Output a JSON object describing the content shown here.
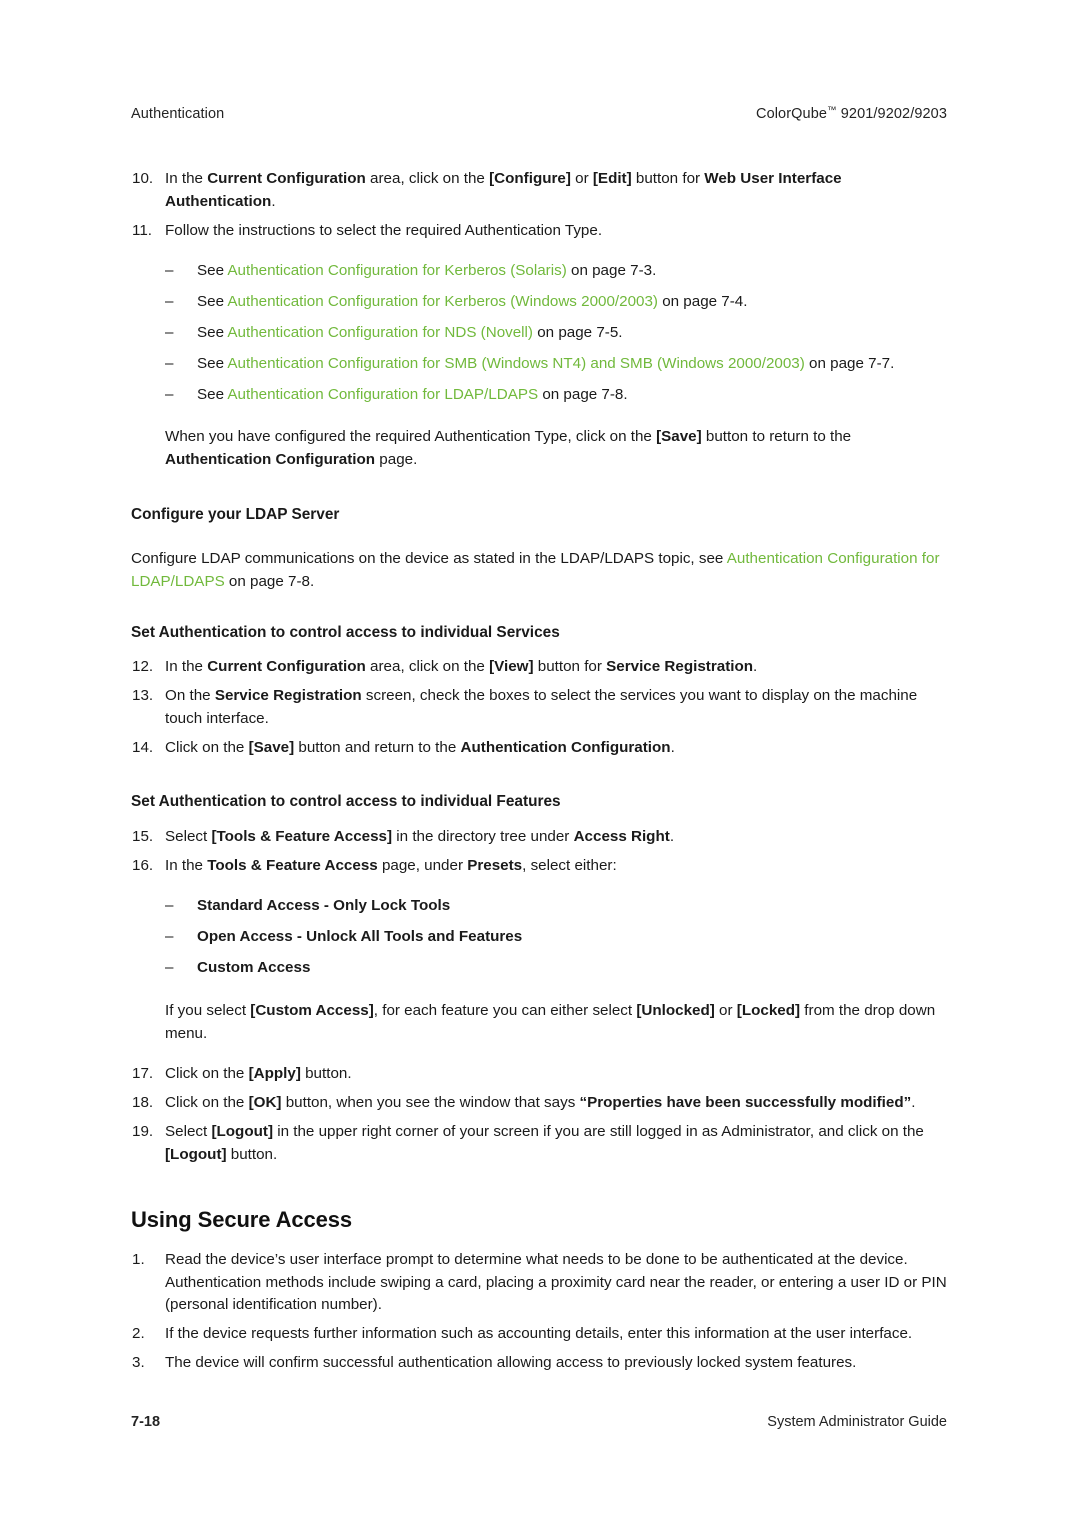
{
  "page": {
    "background": "#ffffff",
    "link_color": "#71b93c",
    "text_color": "#1a1a1a"
  },
  "header": {
    "left": "Authentication",
    "right_product": "ColorQube",
    "right_tm": "™",
    "right_models": " 9201/9202/9203"
  },
  "footer": {
    "page_number": "7-18",
    "guide_title": "System Administrator Guide"
  },
  "steps_authentication": [
    {
      "number": "10.",
      "parts": [
        {
          "t": "In the ",
          "s": "n"
        },
        {
          "t": "Current Configuration",
          "s": "b"
        },
        {
          "t": " area, click on the ",
          "s": "n"
        },
        {
          "t": "[Configure]",
          "s": "b"
        },
        {
          "t": " or ",
          "s": "n"
        },
        {
          "t": "[Edit]",
          "s": "b"
        },
        {
          "t": " button for ",
          "s": "n"
        },
        {
          "t": "Web User Interface Authentication",
          "s": "b"
        },
        {
          "t": ".",
          "s": "n"
        }
      ]
    },
    {
      "number": "11.",
      "parts": [
        {
          "t": "Follow the instructions to select the required Authentication Type.",
          "s": "n"
        }
      ]
    }
  ],
  "see_also_bullets": [
    {
      "bullet": "–",
      "parts": [
        {
          "t": "See ",
          "s": "n"
        },
        {
          "t": "Authentication Configuration for Kerberos (Solaris)",
          "s": "l"
        },
        {
          "t": " on page 7-3.",
          "s": "n"
        }
      ]
    },
    {
      "bullet": "–",
      "parts": [
        {
          "t": "See ",
          "s": "n"
        },
        {
          "t": "Authentication Configuration for Kerberos (Windows 2000/2003)",
          "s": "l"
        },
        {
          "t": " on page 7-4.",
          "s": "n"
        }
      ]
    },
    {
      "bullet": "–",
      "parts": [
        {
          "t": "See ",
          "s": "n"
        },
        {
          "t": "Authentication Configuration for NDS (Novell)",
          "s": "l"
        },
        {
          "t": " on page 7-5.",
          "s": "n"
        }
      ]
    },
    {
      "bullet": "–",
      "parts": [
        {
          "t": "See ",
          "s": "n"
        },
        {
          "t": "Authentication Configuration for SMB (Windows NT4) and SMB (Windows 2000/2003)",
          "s": "l"
        },
        {
          "t": " on page 7-7.",
          "s": "n"
        }
      ]
    },
    {
      "bullet": "–",
      "parts": [
        {
          "t": "See ",
          "s": "n"
        },
        {
          "t": "Authentication Configuration for LDAP/LDAPS",
          "s": "l"
        },
        {
          "t": " on page 7-8.",
          "s": "n"
        }
      ]
    }
  ],
  "save_paragraph": {
    "parts": [
      {
        "t": "When you have configured the required Authentication Type, click on the ",
        "s": "n"
      },
      {
        "t": "[Save]",
        "s": "b"
      },
      {
        "t": " button to return to the ",
        "s": "n"
      },
      {
        "t": "Authentication Configuration",
        "s": "b"
      },
      {
        "t": " page.",
        "s": "n"
      }
    ]
  },
  "ldap_section": {
    "heading": "Configure your LDAP Server",
    "paragraph": {
      "parts": [
        {
          "t": "Configure LDAP communications on the device as stated in the LDAP/LDAPS topic, see ",
          "s": "n"
        },
        {
          "t": "Authentication Configuration for LDAP/LDAPS",
          "s": "l"
        },
        {
          "t": " on page 7-8.",
          "s": "n"
        }
      ]
    }
  },
  "services_section": {
    "heading": "Set Authentication to control access to individual Services",
    "steps": [
      {
        "number": "12.",
        "parts": [
          {
            "t": "In the ",
            "s": "n"
          },
          {
            "t": "Current Configuration",
            "s": "b"
          },
          {
            "t": " area, click on the ",
            "s": "n"
          },
          {
            "t": "[View]",
            "s": "b"
          },
          {
            "t": " button for ",
            "s": "n"
          },
          {
            "t": "Service Registration",
            "s": "b"
          },
          {
            "t": ".",
            "s": "n"
          }
        ]
      },
      {
        "number": "13.",
        "parts": [
          {
            "t": "On the ",
            "s": "n"
          },
          {
            "t": "Service Registration",
            "s": "b"
          },
          {
            "t": " screen, check the boxes to select the services you want to display on the machine touch interface.",
            "s": "n"
          }
        ]
      },
      {
        "number": "14.",
        "parts": [
          {
            "t": "Click on the ",
            "s": "n"
          },
          {
            "t": "[Save]",
            "s": "b"
          },
          {
            "t": " button and return to the ",
            "s": "n"
          },
          {
            "t": "Authentication Configuration",
            "s": "b"
          },
          {
            "t": ".",
            "s": "n"
          }
        ]
      }
    ]
  },
  "features_section": {
    "heading": "Set Authentication to control access to individual Features",
    "steps": [
      {
        "number": "15.",
        "parts": [
          {
            "t": "Select ",
            "s": "n"
          },
          {
            "t": "[Tools & Feature Access]",
            "s": "b"
          },
          {
            "t": " in the directory tree under ",
            "s": "n"
          },
          {
            "t": "Access Right",
            "s": "b"
          },
          {
            "t": ".",
            "s": "n"
          }
        ]
      },
      {
        "number": "16.",
        "parts": [
          {
            "t": "In the ",
            "s": "n"
          },
          {
            "t": "Tools & Feature Access",
            "s": "b"
          },
          {
            "t": " page, under ",
            "s": "n"
          },
          {
            "t": "Presets",
            "s": "b"
          },
          {
            "t": ", select either:",
            "s": "n"
          }
        ]
      }
    ],
    "preset_bullets": [
      {
        "bullet": "–",
        "label": "Standard Access - Only Lock Tools"
      },
      {
        "bullet": "–",
        "label": "Open Access - Unlock All Tools and Features"
      },
      {
        "bullet": "–",
        "label": "Custom Access"
      }
    ],
    "custom_access_paragraph": {
      "parts": [
        {
          "t": "If you select ",
          "s": "n"
        },
        {
          "t": "[Custom Access]",
          "s": "b"
        },
        {
          "t": ", for each feature you can either select ",
          "s": "n"
        },
        {
          "t": "[Unlocked]",
          "s": "b"
        },
        {
          "t": " or ",
          "s": "n"
        },
        {
          "t": "[Locked]",
          "s": "b"
        },
        {
          "t": " from the drop down menu.",
          "s": "n"
        }
      ]
    },
    "final_steps": [
      {
        "number": "17.",
        "parts": [
          {
            "t": "Click on the ",
            "s": "n"
          },
          {
            "t": "[Apply]",
            "s": "b"
          },
          {
            "t": " button.",
            "s": "n"
          }
        ]
      },
      {
        "number": "18.",
        "parts": [
          {
            "t": "Click on the ",
            "s": "n"
          },
          {
            "t": "[OK]",
            "s": "b"
          },
          {
            "t": " button, when you see the window that says ",
            "s": "n"
          },
          {
            "t": "“Properties have been successfully modified”",
            "s": "b"
          },
          {
            "t": ".",
            "s": "n"
          }
        ]
      },
      {
        "number": "19.",
        "parts": [
          {
            "t": "Select ",
            "s": "n"
          },
          {
            "t": "[Logout]",
            "s": "b"
          },
          {
            "t": " in the upper right corner of your screen if you are still logged in as Administrator, and click on the ",
            "s": "n"
          },
          {
            "t": "[Logout]",
            "s": "b"
          },
          {
            "t": " button.",
            "s": "n"
          }
        ]
      }
    ]
  },
  "secure_access_section": {
    "heading": "Using Secure Access",
    "steps": [
      {
        "number": "1.",
        "parts": [
          {
            "t": "Read the device’s user interface prompt to determine what needs to be done to be authenticated at the device. Authentication methods include swiping a card, placing a proximity card near the reader, or entering a user ID or PIN (personal identification number).",
            "s": "n"
          }
        ]
      },
      {
        "number": "2.",
        "parts": [
          {
            "t": "If the device requests further information such as accounting details, enter this information at the user interface.",
            "s": "n"
          }
        ]
      },
      {
        "number": "3.",
        "parts": [
          {
            "t": "The device will confirm successful authentication allowing access to previously locked system features.",
            "s": "n"
          }
        ]
      }
    ]
  }
}
